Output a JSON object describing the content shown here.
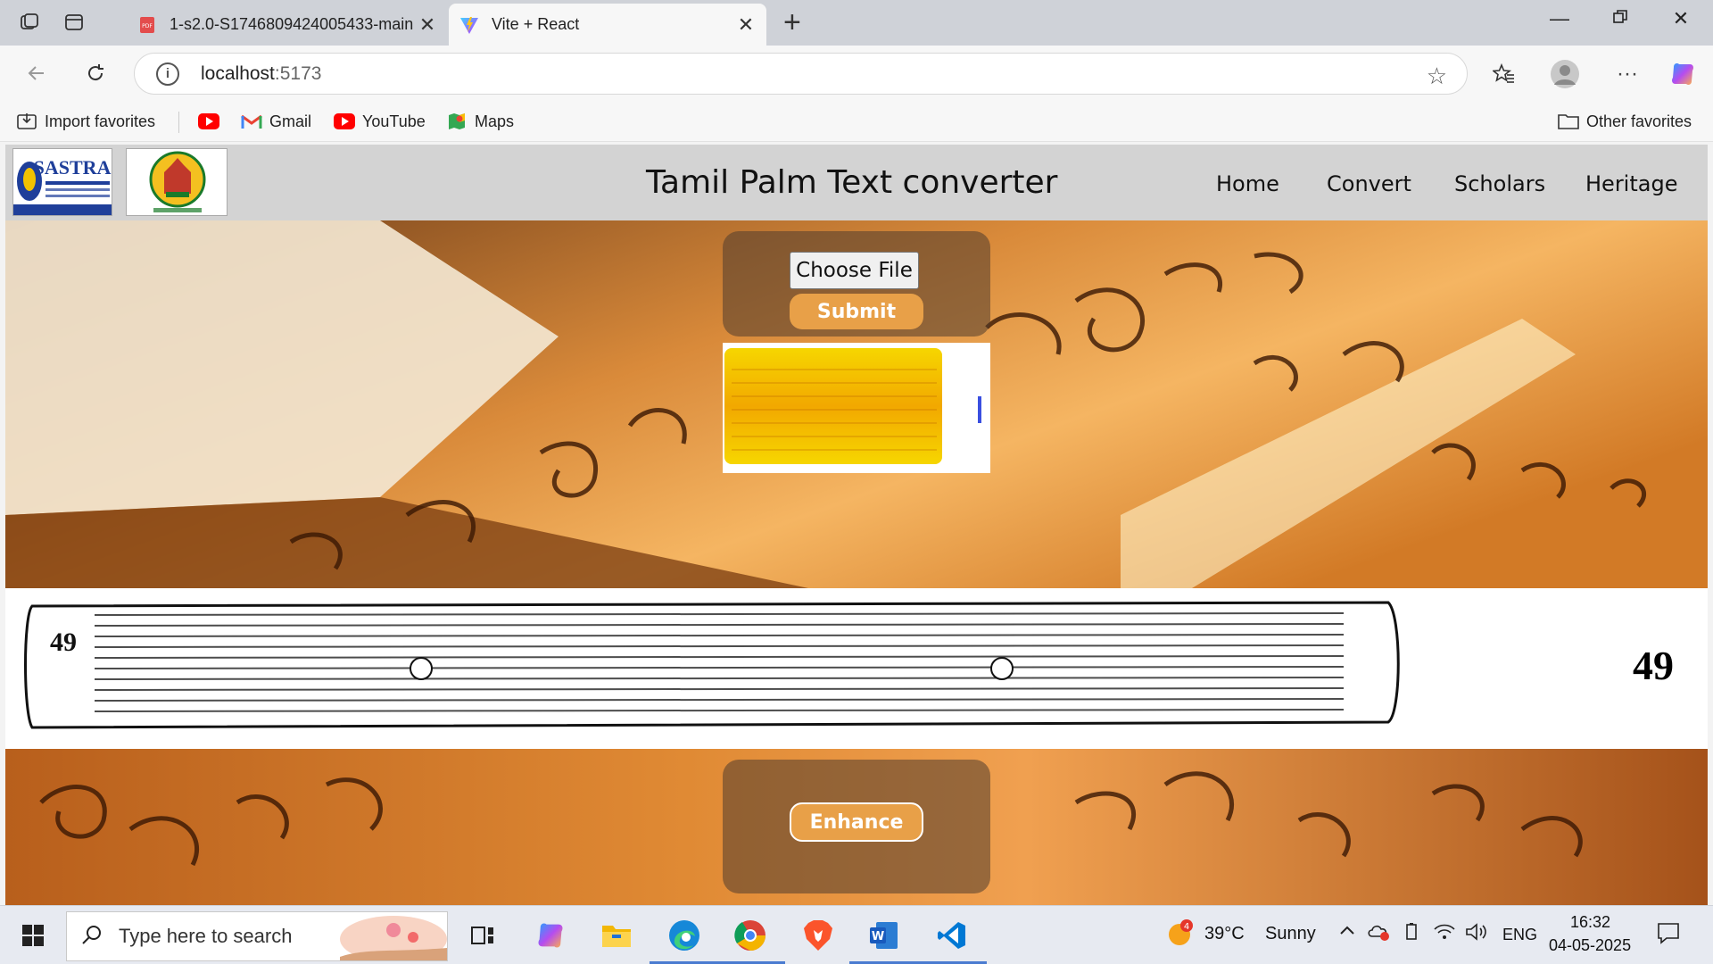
{
  "browser": {
    "tabs": [
      {
        "title": "1-s2.0-S1746809424005433-main",
        "favicon": "pdf-icon",
        "active": false
      },
      {
        "title": "Vite + React",
        "favicon": "vite-icon",
        "active": true
      }
    ],
    "address": {
      "host": "localhost",
      "port": ":5173"
    },
    "bookmarks": [
      {
        "label": "Import favorites",
        "icon": "import-icon"
      },
      {
        "label": "",
        "icon": "youtube-icon"
      },
      {
        "label": "Gmail",
        "icon": "gmail-icon"
      },
      {
        "label": "YouTube",
        "icon": "youtube-icon"
      },
      {
        "label": "Maps",
        "icon": "maps-icon"
      },
      {
        "label": "Other favorites",
        "icon": "folder-icon"
      }
    ]
  },
  "site": {
    "title": "Tamil Palm Text converter",
    "logo1_text": "SASTRA",
    "nav": [
      "Home",
      "Convert",
      "Scholars",
      "Heritage"
    ],
    "choose_file": "Choose File",
    "submit": "Submit",
    "enhance": "Enhance",
    "leaf_number": "49"
  },
  "taskbar": {
    "search_placeholder": "Type here to search",
    "weather": {
      "temp": "39°C",
      "condition": "Sunny",
      "badge": "4"
    },
    "lang": "ENG",
    "time": "16:32",
    "date": "04-05-2025"
  },
  "colors": {
    "accent_button": "#e8a048",
    "header_bg": "#d3d3d3"
  }
}
